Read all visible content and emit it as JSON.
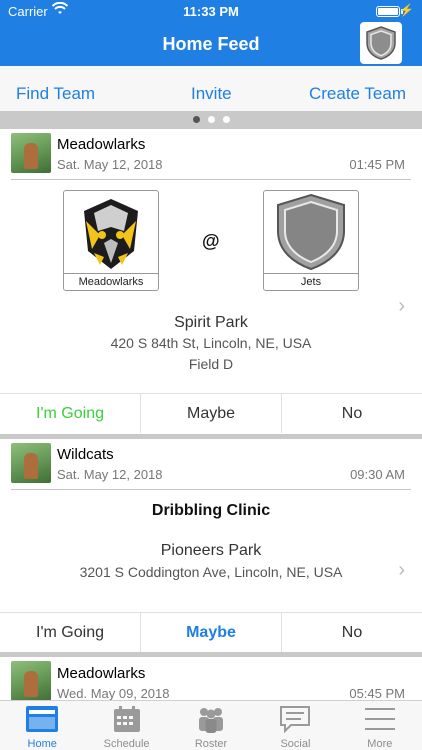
{
  "status": {
    "carrier": "Carrier",
    "time": "11:33 PM"
  },
  "nav": {
    "title": "Home Feed"
  },
  "actions": {
    "find_team": "Find Team",
    "invite": "Invite",
    "create_team": "Create Team"
  },
  "cards": [
    {
      "team": "Meadowlarks",
      "date": "Sat. May 12, 2018",
      "time": "01:45 PM",
      "home_team": "Meadowlarks",
      "at": "@",
      "away_team": "Jets",
      "venue": "Spirit Park",
      "address": "420 S 84th St, Lincoln, NE, USA",
      "field": "Field D",
      "rsvp": [
        "I'm Going",
        "Maybe",
        "No"
      ]
    },
    {
      "team": "Wildcats",
      "date": "Sat. May 12, 2018",
      "time": "09:30 AM",
      "event": "Dribbling Clinic",
      "venue": "Pioneers Park",
      "address": "3201 S Coddington Ave, Lincoln, NE, USA",
      "rsvp": [
        "I'm Going",
        "Maybe",
        "No"
      ]
    },
    {
      "team": "Meadowlarks",
      "date": "Wed. May 09, 2018",
      "time": "05:45 PM"
    }
  ],
  "tabs": [
    "Home",
    "Schedule",
    "Roster",
    "Social",
    "More"
  ],
  "colors": {
    "accent": "#1f7fe3",
    "going": "#39d13a"
  }
}
